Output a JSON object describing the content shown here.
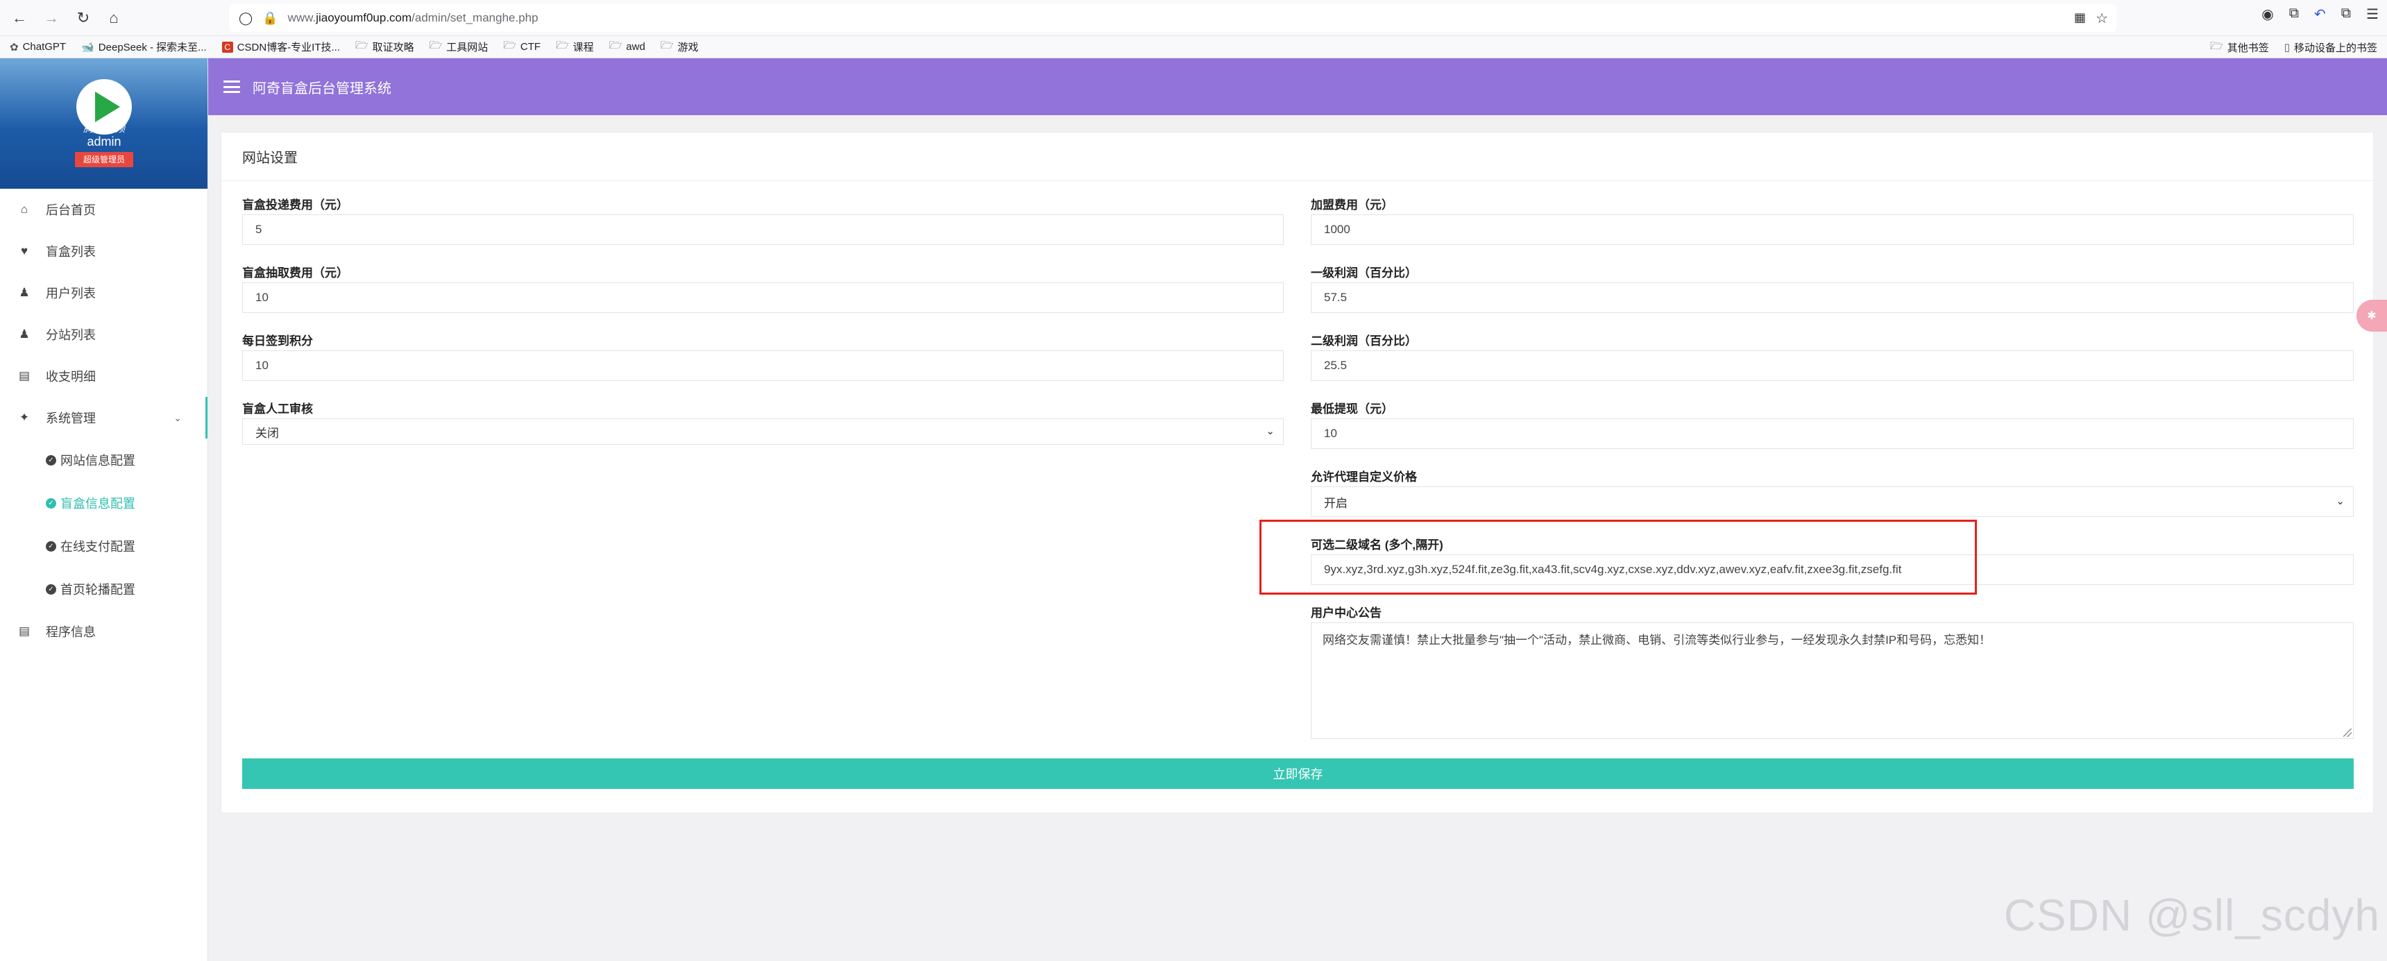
{
  "browser": {
    "url_prefix": "www.",
    "url_domain": "jiaoyoumf0up.com",
    "url_path": "/admin/set_manghe.php",
    "bookmarks": [
      {
        "label": "ChatGPT",
        "icon": "chatgpt-icon"
      },
      {
        "label": "DeepSeek - 探索未至...",
        "icon": "deepseek-icon"
      },
      {
        "label": "CSDN博客-专业IT技...",
        "icon": "csdn-icon"
      },
      {
        "label": "取证攻略",
        "icon": "folder-icon"
      },
      {
        "label": "工具网站",
        "icon": "folder-icon"
      },
      {
        "label": "CTF",
        "icon": "folder-icon"
      },
      {
        "label": "课程",
        "icon": "folder-icon"
      },
      {
        "label": "awd",
        "icon": "folder-icon"
      },
      {
        "label": "游戏",
        "icon": "folder-icon"
      }
    ],
    "bookmarks_right": [
      "其他书签",
      "移动设备上的书签"
    ]
  },
  "sidebar": {
    "avatar_text": "腾讯视频",
    "admin_name": "admin",
    "role": "超级管理员",
    "menu": [
      {
        "label": "后台首页",
        "icon": "home-icon"
      },
      {
        "label": "盲盒列表",
        "icon": "heart-icon"
      },
      {
        "label": "用户列表",
        "icon": "user-icon"
      },
      {
        "label": "分站列表",
        "icon": "user-icon"
      },
      {
        "label": "收支明细",
        "icon": "ledger-icon"
      },
      {
        "label": "系统管理",
        "icon": "settings-sparkle-icon"
      }
    ],
    "submenu": [
      {
        "label": "网站信息配置"
      },
      {
        "label": "盲盒信息配置"
      },
      {
        "label": "在线支付配置"
      },
      {
        "label": "首页轮播配置"
      }
    ],
    "bottom_item": {
      "label": "程序信息",
      "icon": "info-panel-icon"
    }
  },
  "header": {
    "title": "阿奇盲盒后台管理系统"
  },
  "card": {
    "title": "网站设置",
    "left": {
      "delivery_fee_label": "盲盒投递费用（元）",
      "delivery_fee_value": "5",
      "draw_fee_label": "盲盒抽取费用（元）",
      "draw_fee_value": "10",
      "checkin_label": "每日签到积分",
      "checkin_value": "10",
      "review_label": "盲盒人工审核",
      "review_value": "关闭"
    },
    "right": {
      "join_fee_label": "加盟费用（元）",
      "join_fee_value": "1000",
      "level1_label": "一级利润（百分比）",
      "level1_value": "57.5",
      "level2_label": "二级利润（百分比）",
      "level2_value": "25.5",
      "min_withdraw_label": "最低提现（元）",
      "min_withdraw_value": "10",
      "custom_price_label": "允许代理自定义价格",
      "custom_price_value": "开启",
      "subdomain_label": "可选二级域名 (多个,隔开)",
      "subdomain_value": "9yx.xyz,3rd.xyz,g3h.xyz,524f.fit,ze3g.fit,xa43.fit,scv4g.xyz,cxse.xyz,ddv.xyz,awev.xyz,eafv.fit,zxee3g.fit,zsefg.fit",
      "notice_label": "用户中心公告",
      "notice_value": "网络交友需谨慎！禁止大批量参与\"抽一个\"活动，禁止微商、电销、引流等类似行业参与，一经发现永久封禁IP和号码，忘悉知！"
    },
    "save_label": "立即保存"
  },
  "watermark": "CSDN @sll_scdyh",
  "colors": {
    "header": "#9173d9",
    "accent": "#35c6b3",
    "highlight": "#e8201a"
  }
}
